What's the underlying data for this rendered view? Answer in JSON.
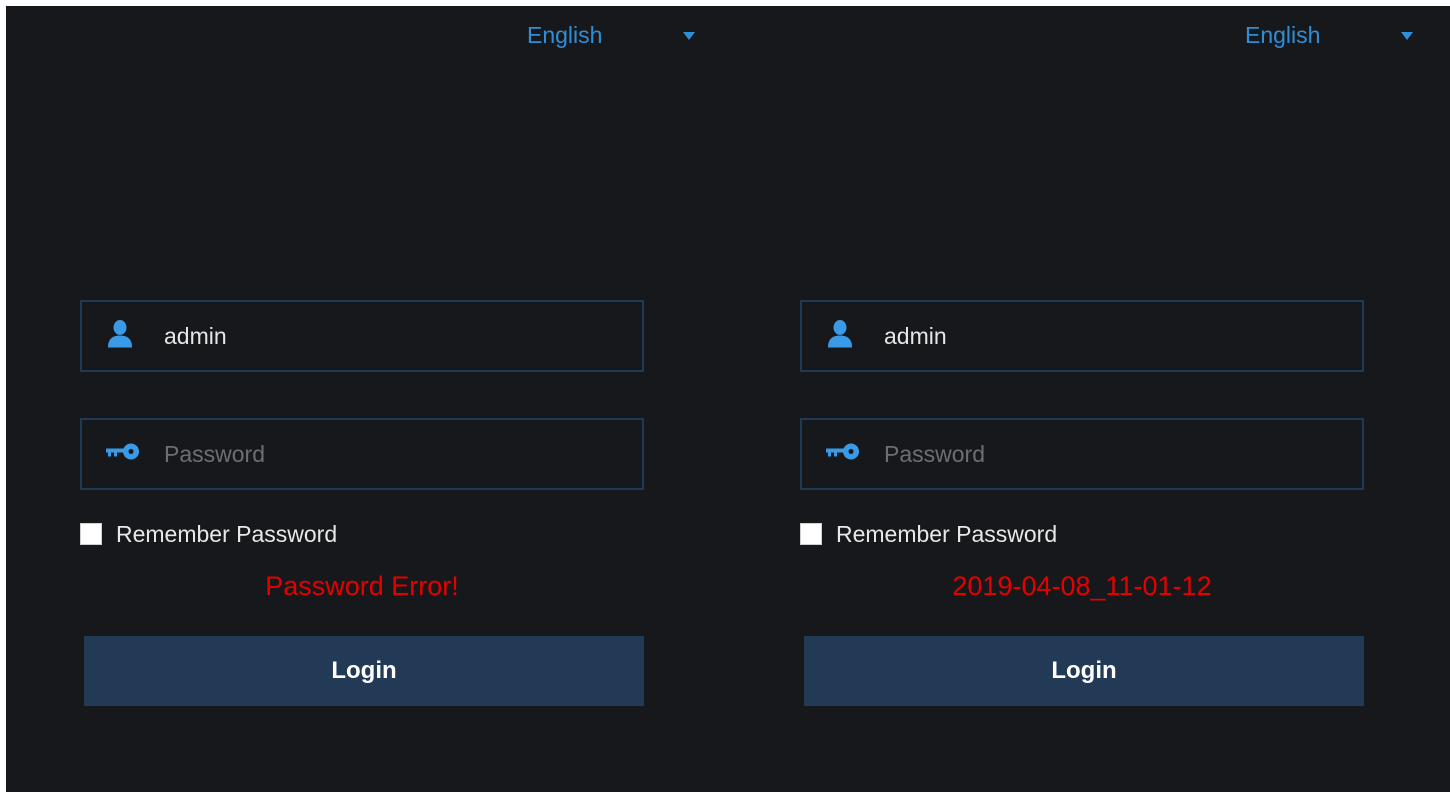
{
  "panels": [
    {
      "language": "English",
      "username": "admin",
      "password_placeholder": "Password",
      "remember_label": "Remember Password",
      "message": "Password Error!",
      "login_label": "Login"
    },
    {
      "language": "English",
      "username": "admin",
      "password_placeholder": "Password",
      "remember_label": "Remember Password",
      "message": "2019-04-08_11-01-12",
      "login_label": "Login"
    }
  ],
  "colors": {
    "background": "#17181c",
    "accent": "#2f8fd6",
    "field_border": "#1f3a55",
    "button": "#223a55",
    "error": "#e50000"
  },
  "icons": {
    "user": "user-icon",
    "password": "key-icon",
    "dropdown": "chevron-down-icon"
  }
}
